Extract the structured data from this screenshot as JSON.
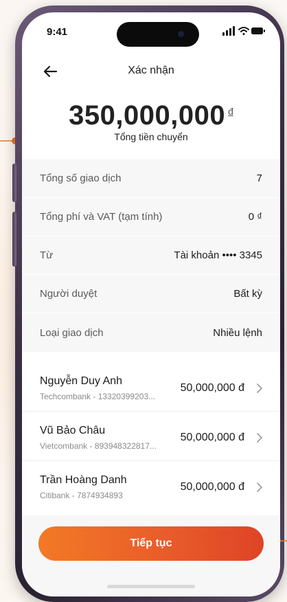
{
  "status_bar": {
    "time": "9:41"
  },
  "header": {
    "title": "Xác nhận"
  },
  "amount": {
    "value": "350,000,000",
    "currency": "đ",
    "label": "Tổng tiền chuyển"
  },
  "summary": [
    {
      "label": "Tổng số giao dịch",
      "value": "7"
    },
    {
      "label": "Tổng phí và VAT (tạm tính)",
      "value": "0 ₫"
    },
    {
      "label": "Từ",
      "value": "Tài khoản •••• 3345"
    },
    {
      "label": "Người duyệt",
      "value": "Bất kỳ"
    },
    {
      "label": "Loại giao dịch",
      "value": "Nhiều lệnh"
    }
  ],
  "recipients": [
    {
      "name": "Nguyễn Duy Anh",
      "bank": "Techcombank - 13320399203...",
      "amount": "50,000,000 đ"
    },
    {
      "name": "Vũ Bảo Châu",
      "bank": "Vietcombank - 893948322817...",
      "amount": "50,000,000 đ"
    },
    {
      "name": "Trần Hoàng Danh",
      "bank": "Citibank - 7874934893",
      "amount": "50,000,000 đ"
    }
  ],
  "actions": {
    "continue_label": "Tiếp tục"
  },
  "colors": {
    "accent": "#e85a2a",
    "accent_start": "#f27a25"
  },
  "icons": [
    "back-arrow-icon",
    "signal-icon",
    "wifi-icon",
    "battery-icon",
    "chevron-right-icon"
  ]
}
